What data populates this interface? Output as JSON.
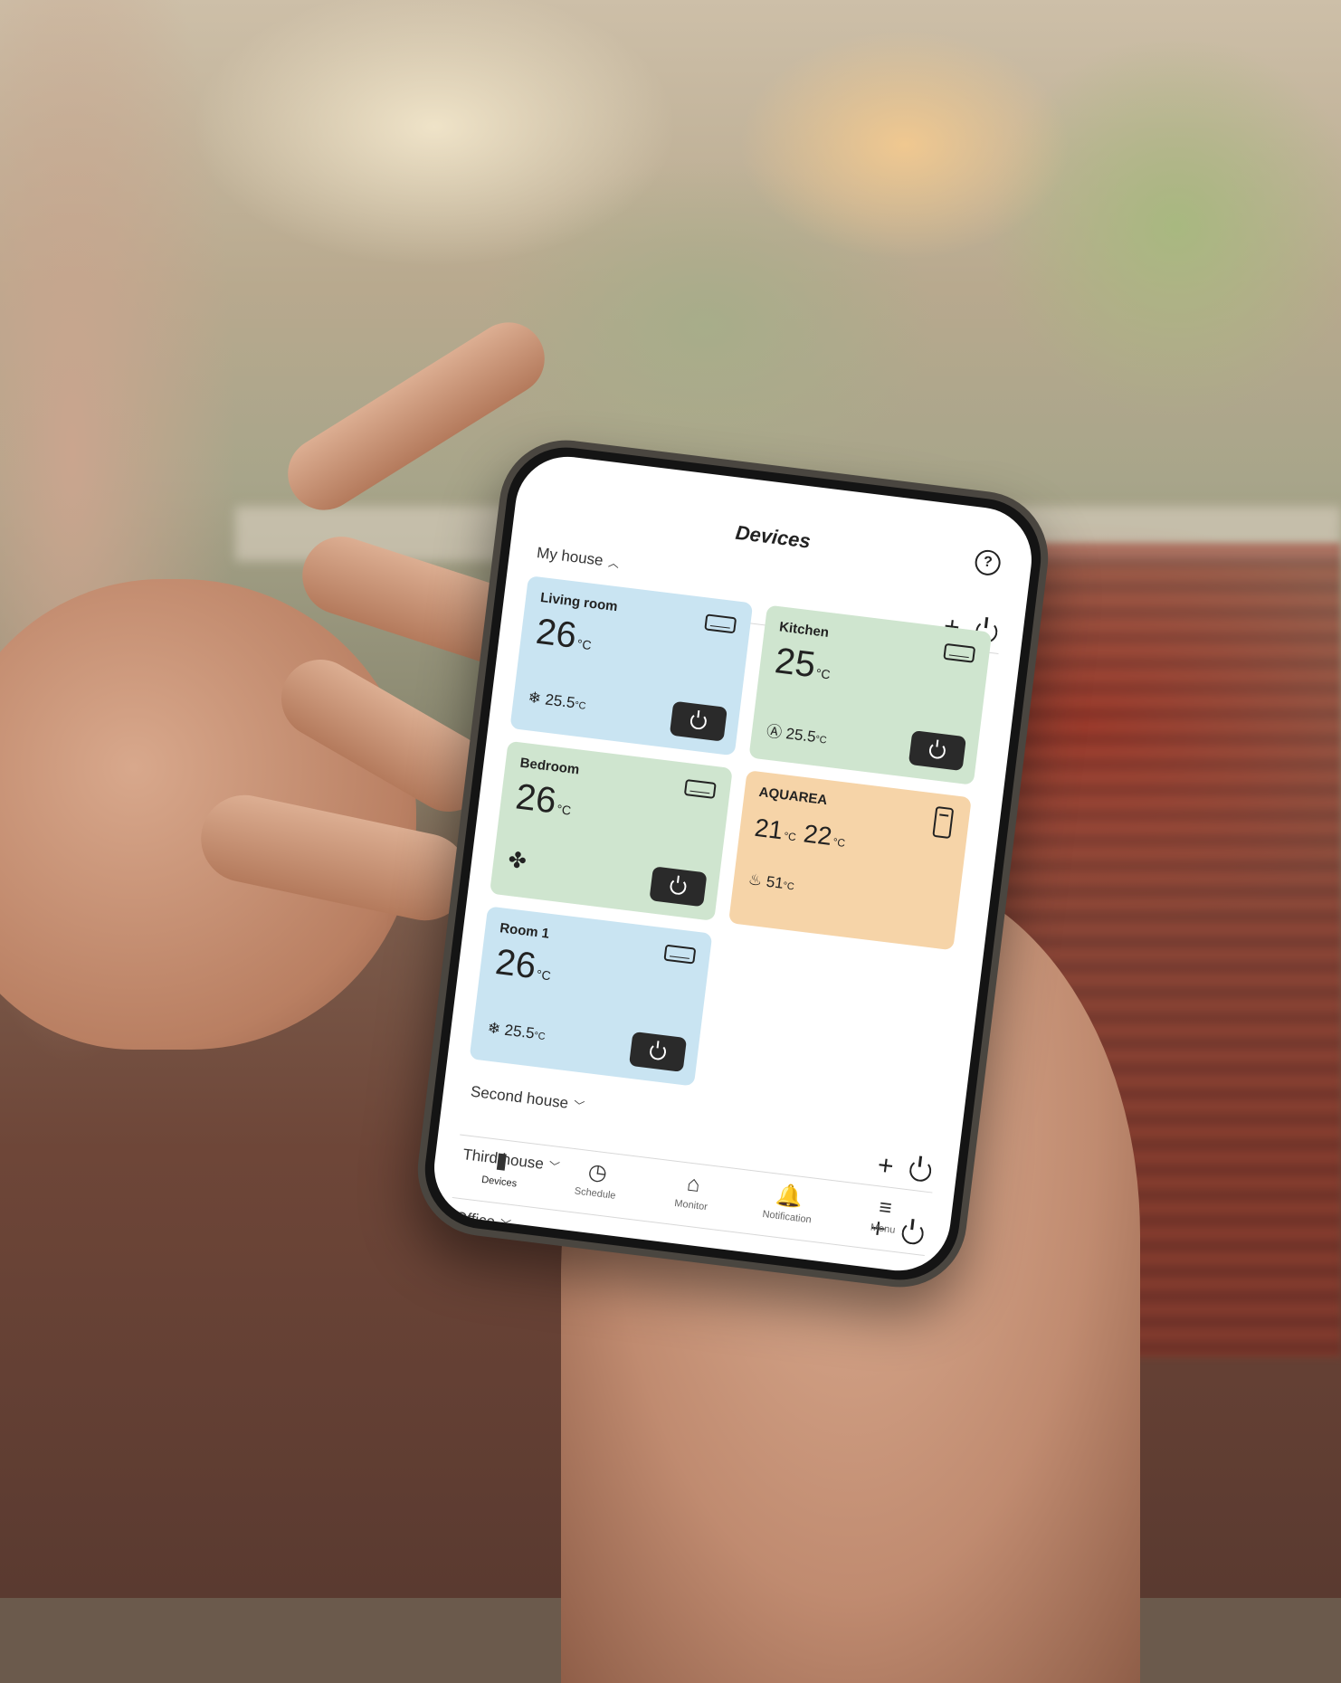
{
  "screen": {
    "title": "Devices",
    "help_icon": "help-icon"
  },
  "groups": [
    {
      "name": "My house",
      "expanded": true
    },
    {
      "name": "Second house",
      "expanded": false
    },
    {
      "name": "Third house",
      "expanded": false
    },
    {
      "name": "Office",
      "expanded": false
    }
  ],
  "devices": [
    {
      "name": "Living room",
      "temp": "26",
      "unit": "°C",
      "mode_icon": "snowflake-icon",
      "mode_glyph": "❄",
      "current": "25.5",
      "current_unit": "°C",
      "color": "#c9e4f2",
      "type_icon": "air-conditioner-icon"
    },
    {
      "name": "Kitchen",
      "temp": "25",
      "unit": "°C",
      "mode_icon": "auto-icon",
      "mode_glyph": "Ⓐ",
      "current": "25.5",
      "current_unit": "°C",
      "color": "#cfe5cf",
      "type_icon": "air-conditioner-icon"
    },
    {
      "name": "Bedroom",
      "temp": "26",
      "unit": "°C",
      "mode_icon": "fan-icon",
      "mode_glyph": "✤",
      "current": "",
      "current_unit": "",
      "color": "#cfe5cf",
      "type_icon": "air-conditioner-icon"
    },
    {
      "name": "AQUAREA",
      "temp_a": "21",
      "temp_b": "22",
      "unit": "°C",
      "mode_icon": "outdoor-temp-icon",
      "mode_glyph": "♨",
      "current": "51",
      "current_unit": "°C",
      "color": "#f6d4a8",
      "type_icon": "heat-pump-tank-icon"
    },
    {
      "name": "Room 1",
      "temp": "26",
      "unit": "°C",
      "mode_icon": "snowflake-icon",
      "mode_glyph": "❄",
      "current": "25.5",
      "current_unit": "°C",
      "color": "#c9e4f2",
      "type_icon": "air-conditioner-icon"
    }
  ],
  "nav": [
    {
      "label": "Devices",
      "icon": "device-icon",
      "glyph": "▮",
      "active": true
    },
    {
      "label": "Schedule",
      "icon": "schedule-icon",
      "glyph": "◷",
      "active": false
    },
    {
      "label": "Monitor",
      "icon": "monitor-icon",
      "glyph": "⌂",
      "active": false
    },
    {
      "label": "Notification",
      "icon": "bell-icon",
      "glyph": "🔔",
      "active": false
    },
    {
      "label": "Menu",
      "icon": "menu-icon",
      "glyph": "≡",
      "active": false
    }
  ]
}
